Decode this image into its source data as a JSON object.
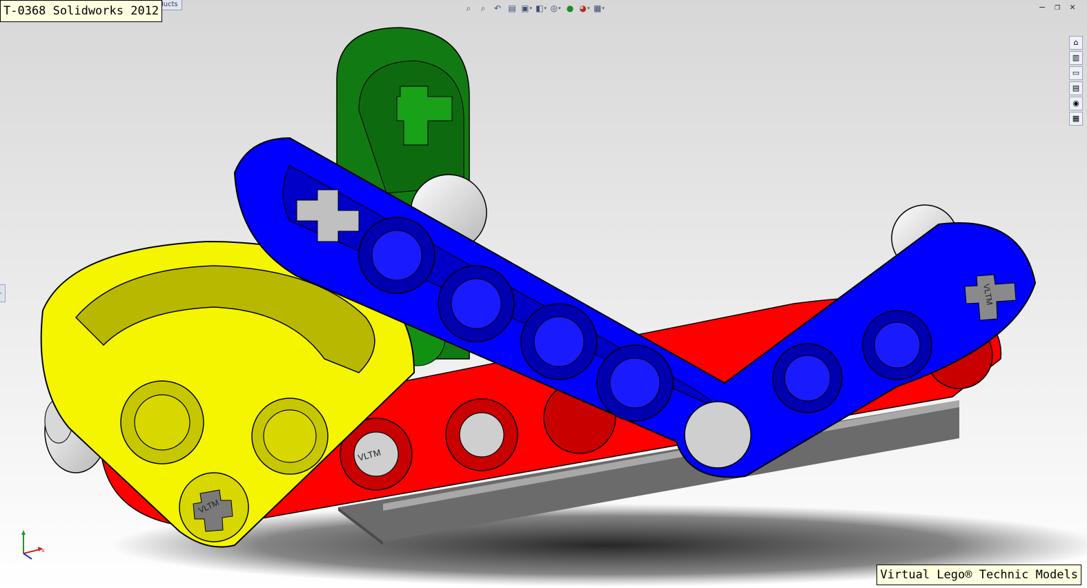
{
  "header": {
    "title_label": "T-0368 Solidworks 2012",
    "tab_fragment": "oducts"
  },
  "footer": {
    "watermark": "Virtual Lego® Technic Models"
  },
  "toolbar": {
    "icons": [
      "zoom-to-fit-icon",
      "zoom-area-icon",
      "previous-view-icon",
      "section-view-icon",
      "view-orientation-icon",
      "display-style-icon",
      "hide-show-icon",
      "edit-appearance-icon",
      "apply-scene-icon",
      "view-settings-icon"
    ]
  },
  "window_controls": [
    "minimize-icon",
    "restore-icon",
    "close-icon"
  ],
  "task_pane": [
    "home-icon",
    "design-library-icon",
    "file-explorer-icon",
    "view-palette-icon",
    "appearances-icon",
    "custom-properties-icon"
  ],
  "part_markings": {
    "pin_text": "VLTM"
  },
  "colors": {
    "beam_blue": "#0000ff",
    "beam_red": "#ff0000",
    "beam_green": "#129012",
    "frame_yellow": "#f5f500",
    "base_gray": "#8f8f8f"
  }
}
